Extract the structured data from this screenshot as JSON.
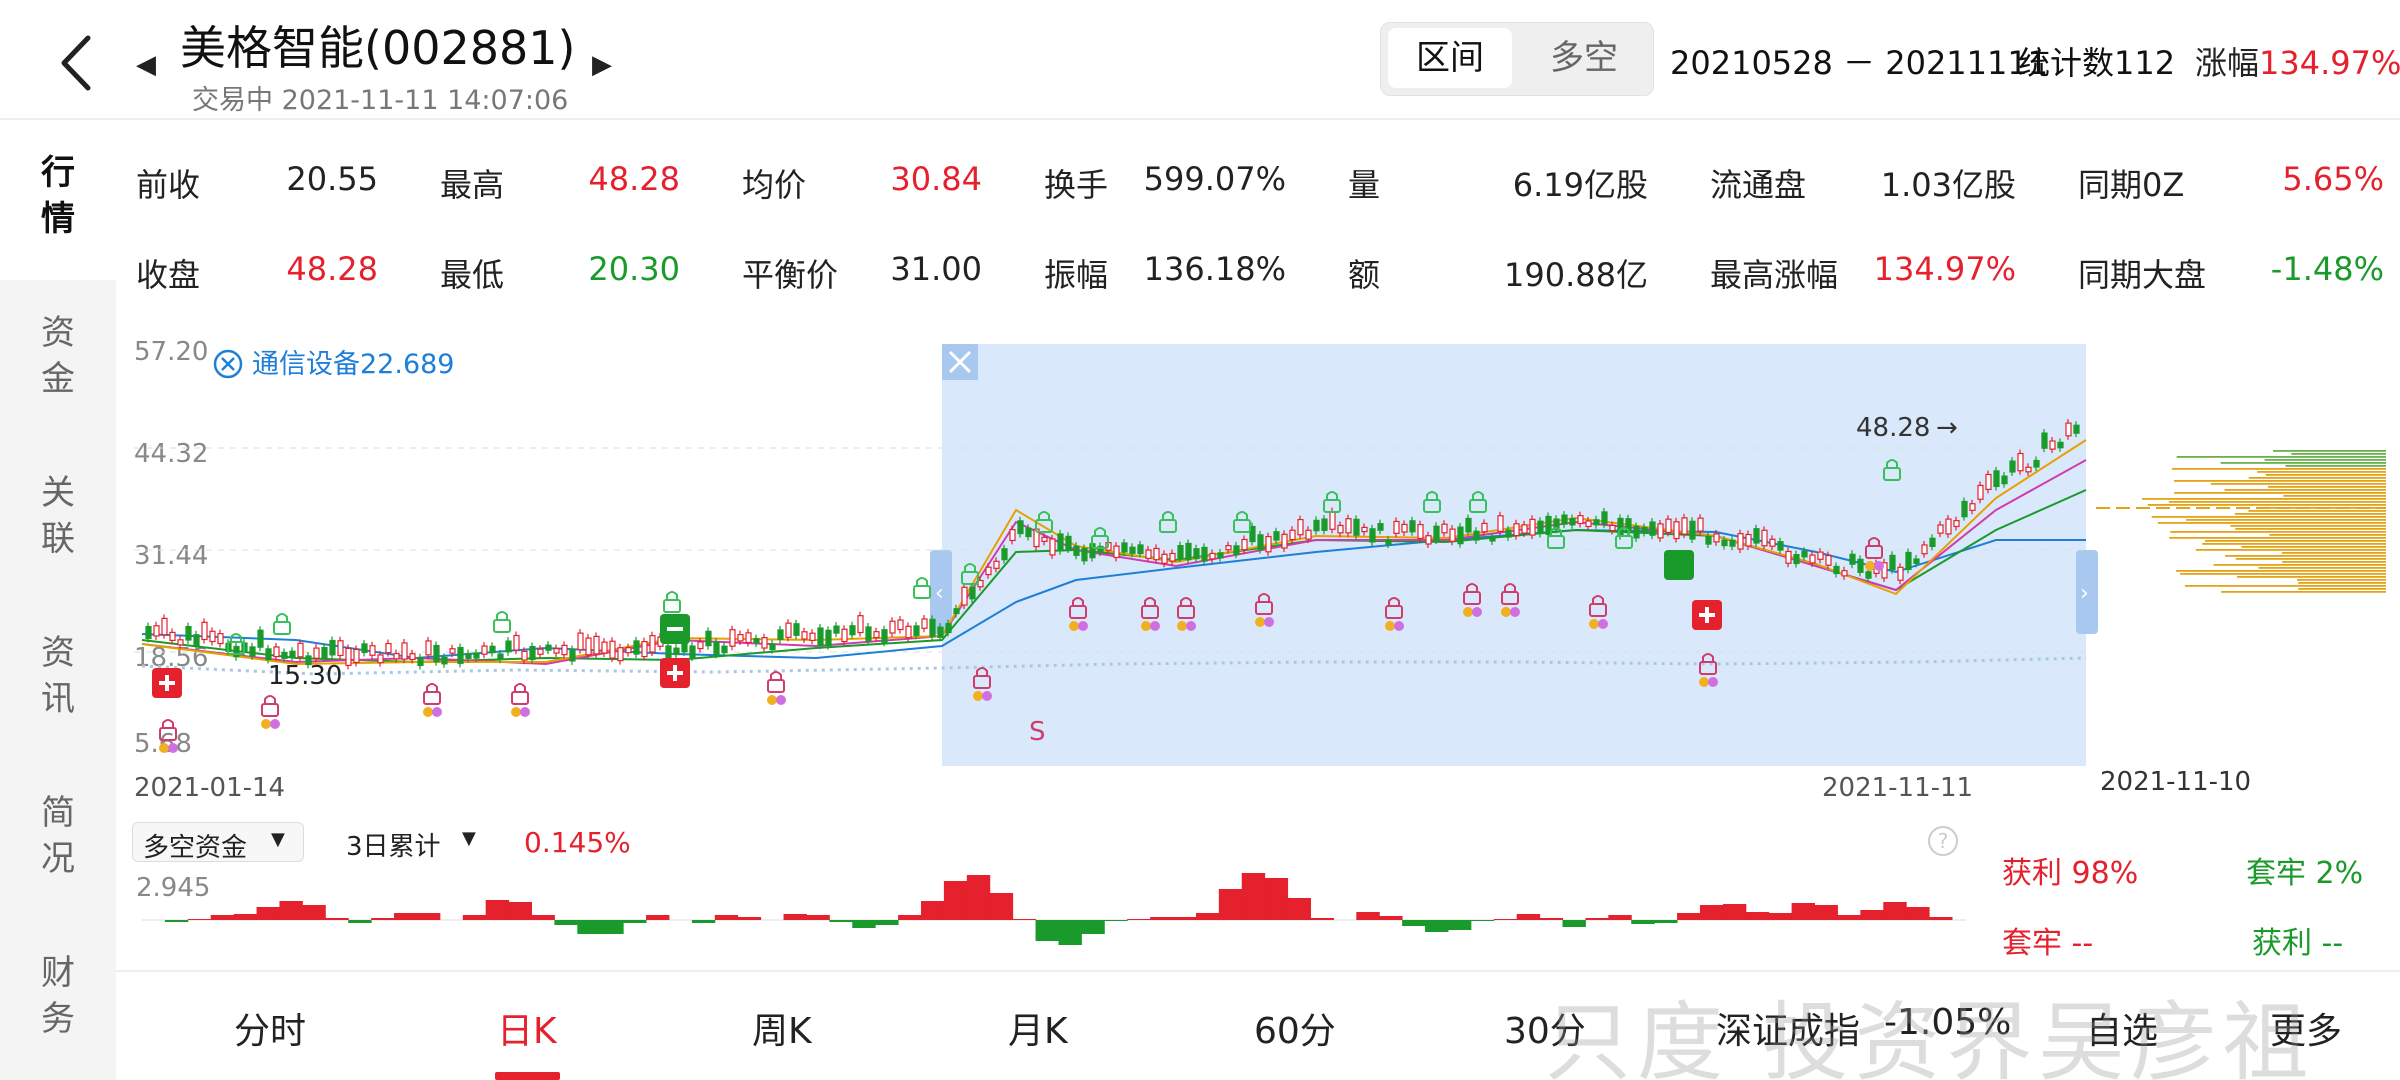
{
  "header": {
    "stock_name": "美格智能(002881)",
    "status": "交易中 2021-11-11 14:07:06",
    "segment": [
      "区间",
      "多空"
    ],
    "range": "20210528 － 20211111",
    "count": "统计数112",
    "change_label": "涨幅",
    "change_value": "134.97%"
  },
  "sidebar": [
    {
      "label": "行\n情",
      "active": true
    },
    {
      "label": "资\n金"
    },
    {
      "label": "关\n联"
    },
    {
      "label": "资\n讯"
    },
    {
      "label": "简\n况"
    },
    {
      "label": "财\n务"
    }
  ],
  "stats": {
    "row1": [
      {
        "label": "前收",
        "value": "20.55",
        "color": "#222"
      },
      {
        "label": "最高",
        "value": "48.28",
        "color": "#e4212d"
      },
      {
        "label": "均价",
        "value": "30.84",
        "color": "#e4212d"
      },
      {
        "label": "换手",
        "value": "599.07%",
        "color": "#222"
      },
      {
        "label": "量",
        "value": "6.19亿股",
        "color": "#222"
      },
      {
        "label": "流通盘",
        "value": "1.03亿股",
        "color": "#222"
      },
      {
        "label": "同期0Z",
        "value": "5.65%",
        "color": "#e4212d"
      }
    ],
    "row2": [
      {
        "label": "收盘",
        "value": "48.28",
        "color": "#e4212d"
      },
      {
        "label": "最低",
        "value": "20.30",
        "color": "#1a9a2a"
      },
      {
        "label": "平衡价",
        "value": "31.00",
        "color": "#222"
      },
      {
        "label": "振幅",
        "value": "136.18%",
        "color": "#222"
      },
      {
        "label": "额",
        "value": "190.88亿",
        "color": "#222"
      },
      {
        "label": "最高涨幅",
        "value": "134.97%",
        "color": "#e4212d"
      },
      {
        "label": "同期大盘",
        "value": "-1.48%",
        "color": "#1a9a2a"
      }
    ]
  },
  "chart": {
    "y_ticks": [
      "57.20",
      "44.32",
      "31.44",
      "18.56",
      "5.68"
    ],
    "low_label": "15.30",
    "high_label": "48.28",
    "industry": "通信设备22.689",
    "x_start": "2021-01-14",
    "x_end": "2021-11-11",
    "profile_date": "2021-11-10",
    "s_marker": "S"
  },
  "chart_data": {
    "type": "candlestick",
    "x_start": "2021-01-14",
    "x_end": "2021-11-11",
    "ylim": [
      5.68,
      57.2
    ],
    "y_ticks": [
      57.2,
      44.32,
      31.44,
      18.56,
      5.68
    ],
    "selected_range": [
      "20210528",
      "20211111"
    ],
    "annotations": {
      "high": 48.28,
      "low": 15.3
    }
  },
  "indicator": {
    "dropdown1": "多空资金",
    "dropdown2": "3日累计",
    "value": "0.145%",
    "y_tick": "2.945"
  },
  "profit": {
    "win_label": "获利 98%",
    "trap_label": "套牢 2%",
    "trap_label2": "套牢 --",
    "win_label2": "获利 --"
  },
  "tabs": [
    "分时",
    "日K",
    "周K",
    "月K",
    "60分",
    "30分",
    "深证成指",
    "-1.05%",
    "自选",
    "更多"
  ],
  "watermark": "只度 投资界吴彦祖",
  "colors": {
    "up": "#e4212d",
    "down": "#1a9a2a",
    "accent": "#1e7ed8"
  }
}
